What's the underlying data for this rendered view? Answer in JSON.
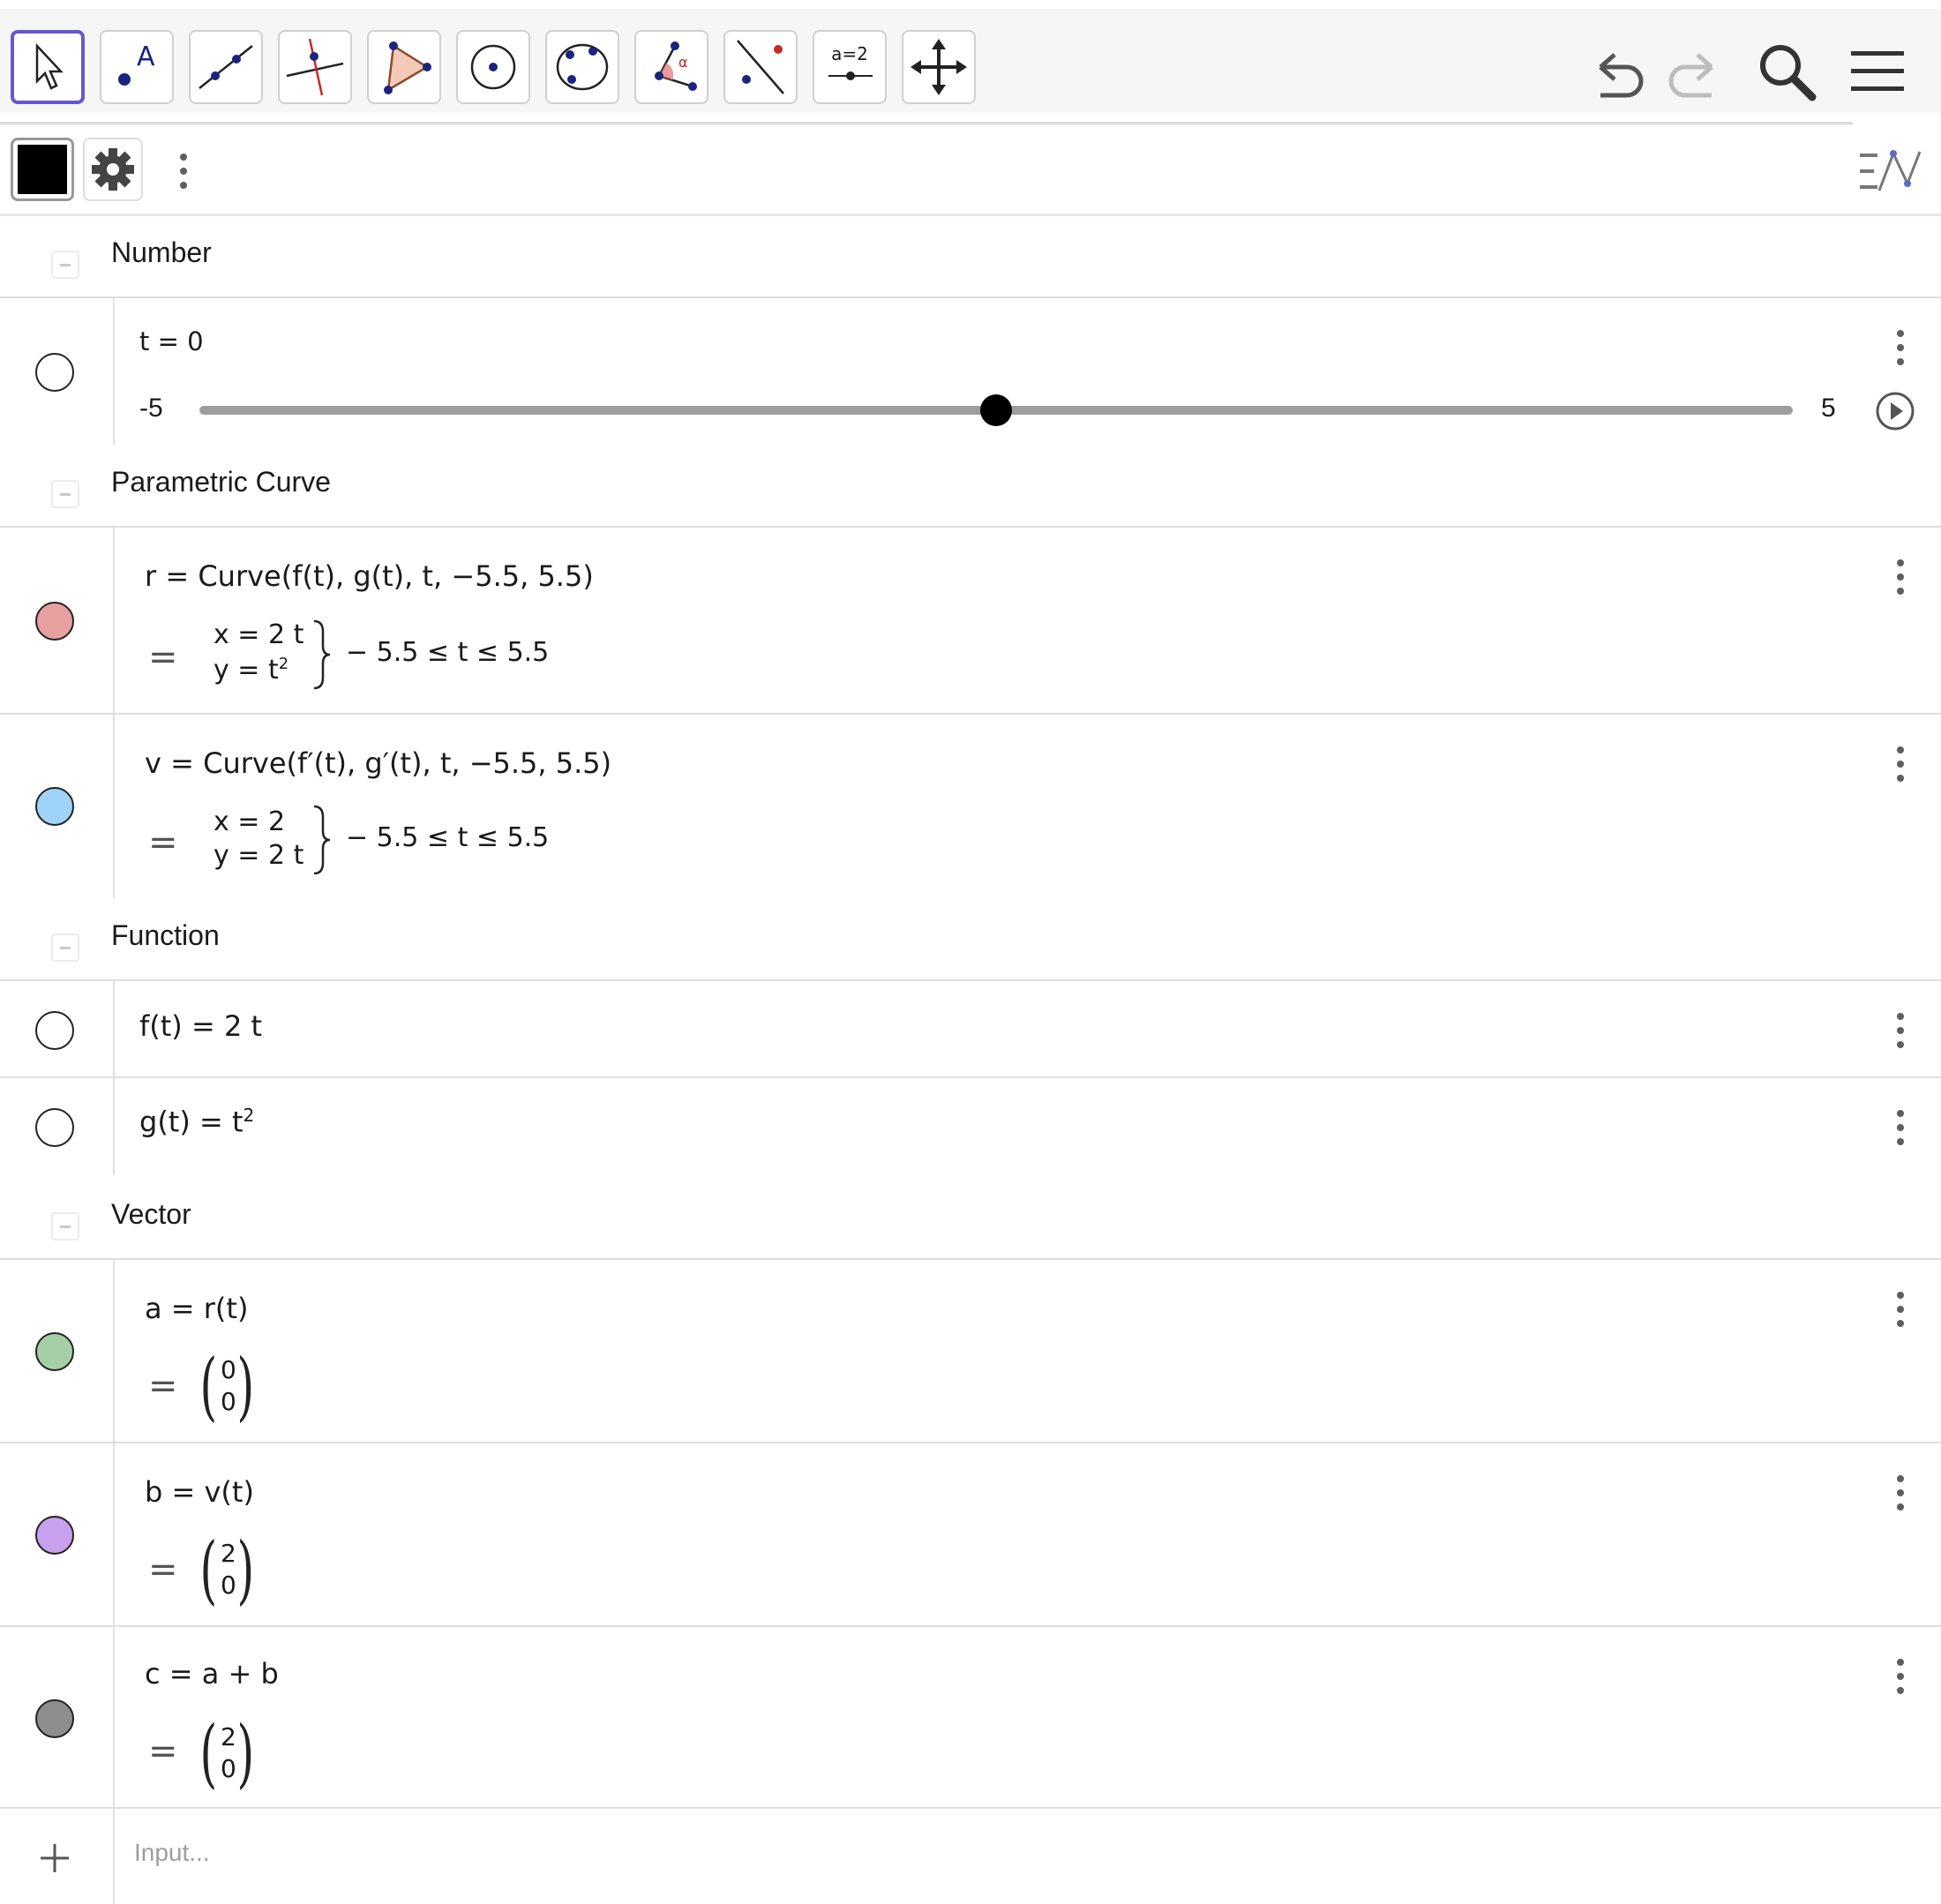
{
  "toolbar": {
    "tools": [
      "move",
      "point",
      "line",
      "perpendicular",
      "polygon",
      "circle-center-point",
      "conic",
      "angle",
      "reflect",
      "slider",
      "move-graphics"
    ],
    "slider_tool_label": "a=2",
    "icons": [
      "undo-icon",
      "redo-icon",
      "search-icon",
      "menu-icon"
    ]
  },
  "stylebar": {
    "color": "#000000",
    "icons": [
      "settings-icon",
      "more-icon",
      "graphing-toggle-icon"
    ]
  },
  "algebra": {
    "sections": {
      "number": "Number",
      "parametric": "Parametric Curve",
      "function": "Function",
      "vector": "Vector"
    },
    "slider": {
      "definition": "t = 0",
      "min": "-5",
      "max": "5",
      "value": 0
    },
    "r": {
      "definition": "r = Curve(f(t), g(t), t, −5.5, 5.5)",
      "x": "x = 2 t",
      "y": "y = t",
      "y_exp": "2",
      "range": "− 5.5 ≤ t ≤ 5.5",
      "color": "#e8a0a0"
    },
    "v": {
      "definition": "v = Curve(f′(t), g′(t), t, −5.5, 5.5)",
      "x": "x = 2",
      "y": "y = 2 t",
      "range": "− 5.5 ≤ t ≤ 5.5",
      "color": "#9fd3f7"
    },
    "f": {
      "definition": "f(t) = 2 t"
    },
    "g": {
      "definition": "g(t) = t",
      "exp": "2"
    },
    "a": {
      "definition": "a = r(t)",
      "v1": "0",
      "v2": "0",
      "color": "#a7cfa5"
    },
    "b": {
      "definition": "b = v(t)",
      "v1": "2",
      "v2": "0",
      "color": "#c7a0ee"
    },
    "c": {
      "definition": "c = a + b",
      "v1": "2",
      "v2": "0",
      "color": "#8d8d8d"
    },
    "equals": "=",
    "input_placeholder": "Input..."
  }
}
